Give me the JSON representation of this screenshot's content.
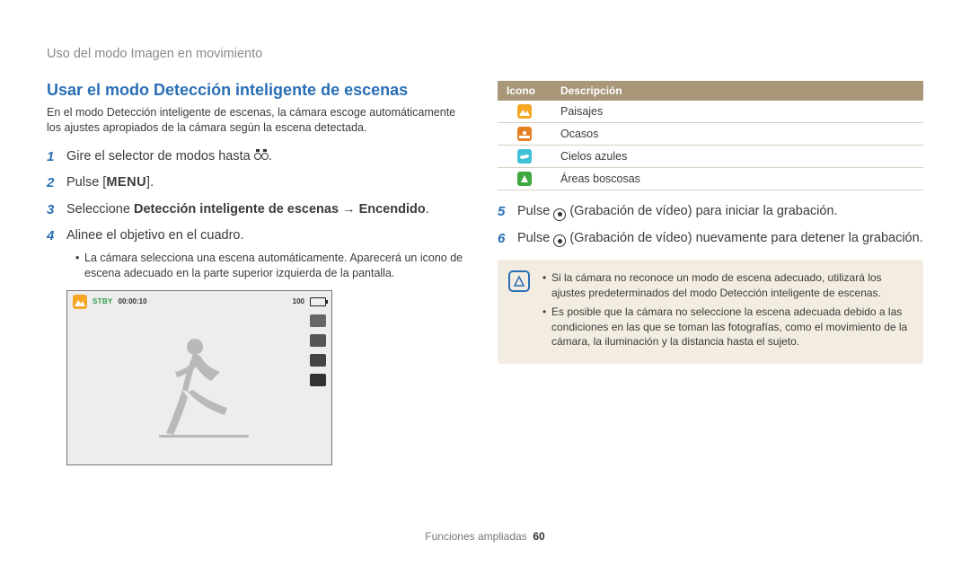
{
  "breadcrumb": "Uso del modo Imagen en movimiento",
  "title": "Usar el modo Detección inteligente de escenas",
  "intro": "En el modo Detección inteligente de escenas, la cámara escoge automáticamente los ajustes apropiados de la cámara según la escena detectada.",
  "steps": {
    "s1": "Gire el selector de modos hasta ",
    "s1_end": ".",
    "s2_a": "Pulse [",
    "s2_menu": "MENU",
    "s2_b": "].",
    "s3_a": "Seleccione ",
    "s3_b": "Detección inteligente de escenas",
    "s3_c": " → ",
    "s3_d": "Encendido",
    "s3_e": ".",
    "s4": "Alinee el objetivo en el cuadro.",
    "s4_bullet": "La cámara selecciona una escena automáticamente. Aparecerá un icono de escena adecuado en la parte superior izquierda de la pantalla.",
    "s5_a": "Pulse ",
    "s5_b": " (Grabación de vídeo) para iniciar la grabación.",
    "s6_a": "Pulse ",
    "s6_b": " (Grabación de vídeo) nuevamente para detener la grabación."
  },
  "camera": {
    "stby": "STBY",
    "time": "00:00:10",
    "count": "100"
  },
  "table": {
    "head_icon": "Icono",
    "head_desc": "Descripción",
    "rows": [
      {
        "cls": "sq-landscape",
        "label": "Paisajes"
      },
      {
        "cls": "sq-sunset",
        "label": "Ocasos"
      },
      {
        "cls": "sq-sky",
        "label": "Cielos azules"
      },
      {
        "cls": "sq-forest",
        "label": "Áreas boscosas"
      }
    ]
  },
  "notes": {
    "n1": "Si la cámara no reconoce un modo de escena adecuado, utilizará los ajustes predeterminados del modo Detección inteligente de escenas.",
    "n2": "Es posible que la cámara no seleccione la escena adecuada debido a las condiciones en las que se toman las fotografías, como el movimiento de la cámara, la iluminación y la distancia hasta el sujeto."
  },
  "footer": {
    "section": "Funciones ampliadas",
    "page": "60"
  }
}
